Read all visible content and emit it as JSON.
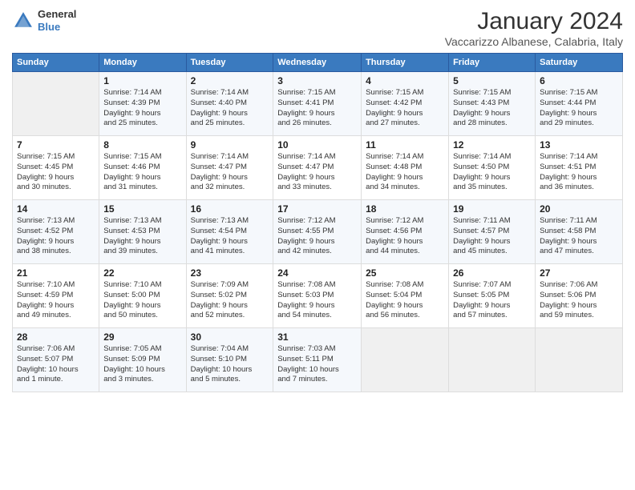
{
  "logo": {
    "general": "General",
    "blue": "Blue"
  },
  "header": {
    "month": "January 2024",
    "location": "Vaccarizzo Albanese, Calabria, Italy"
  },
  "weekdays": [
    "Sunday",
    "Monday",
    "Tuesday",
    "Wednesday",
    "Thursday",
    "Friday",
    "Saturday"
  ],
  "weeks": [
    [
      {
        "day": "",
        "info": ""
      },
      {
        "day": "1",
        "info": "Sunrise: 7:14 AM\nSunset: 4:39 PM\nDaylight: 9 hours\nand 25 minutes."
      },
      {
        "day": "2",
        "info": "Sunrise: 7:14 AM\nSunset: 4:40 PM\nDaylight: 9 hours\nand 25 minutes."
      },
      {
        "day": "3",
        "info": "Sunrise: 7:15 AM\nSunset: 4:41 PM\nDaylight: 9 hours\nand 26 minutes."
      },
      {
        "day": "4",
        "info": "Sunrise: 7:15 AM\nSunset: 4:42 PM\nDaylight: 9 hours\nand 27 minutes."
      },
      {
        "day": "5",
        "info": "Sunrise: 7:15 AM\nSunset: 4:43 PM\nDaylight: 9 hours\nand 28 minutes."
      },
      {
        "day": "6",
        "info": "Sunrise: 7:15 AM\nSunset: 4:44 PM\nDaylight: 9 hours\nand 29 minutes."
      }
    ],
    [
      {
        "day": "7",
        "info": "Sunrise: 7:15 AM\nSunset: 4:45 PM\nDaylight: 9 hours\nand 30 minutes."
      },
      {
        "day": "8",
        "info": "Sunrise: 7:15 AM\nSunset: 4:46 PM\nDaylight: 9 hours\nand 31 minutes."
      },
      {
        "day": "9",
        "info": "Sunrise: 7:14 AM\nSunset: 4:47 PM\nDaylight: 9 hours\nand 32 minutes."
      },
      {
        "day": "10",
        "info": "Sunrise: 7:14 AM\nSunset: 4:47 PM\nDaylight: 9 hours\nand 33 minutes."
      },
      {
        "day": "11",
        "info": "Sunrise: 7:14 AM\nSunset: 4:48 PM\nDaylight: 9 hours\nand 34 minutes."
      },
      {
        "day": "12",
        "info": "Sunrise: 7:14 AM\nSunset: 4:50 PM\nDaylight: 9 hours\nand 35 minutes."
      },
      {
        "day": "13",
        "info": "Sunrise: 7:14 AM\nSunset: 4:51 PM\nDaylight: 9 hours\nand 36 minutes."
      }
    ],
    [
      {
        "day": "14",
        "info": "Sunrise: 7:13 AM\nSunset: 4:52 PM\nDaylight: 9 hours\nand 38 minutes."
      },
      {
        "day": "15",
        "info": "Sunrise: 7:13 AM\nSunset: 4:53 PM\nDaylight: 9 hours\nand 39 minutes."
      },
      {
        "day": "16",
        "info": "Sunrise: 7:13 AM\nSunset: 4:54 PM\nDaylight: 9 hours\nand 41 minutes."
      },
      {
        "day": "17",
        "info": "Sunrise: 7:12 AM\nSunset: 4:55 PM\nDaylight: 9 hours\nand 42 minutes."
      },
      {
        "day": "18",
        "info": "Sunrise: 7:12 AM\nSunset: 4:56 PM\nDaylight: 9 hours\nand 44 minutes."
      },
      {
        "day": "19",
        "info": "Sunrise: 7:11 AM\nSunset: 4:57 PM\nDaylight: 9 hours\nand 45 minutes."
      },
      {
        "day": "20",
        "info": "Sunrise: 7:11 AM\nSunset: 4:58 PM\nDaylight: 9 hours\nand 47 minutes."
      }
    ],
    [
      {
        "day": "21",
        "info": "Sunrise: 7:10 AM\nSunset: 4:59 PM\nDaylight: 9 hours\nand 49 minutes."
      },
      {
        "day": "22",
        "info": "Sunrise: 7:10 AM\nSunset: 5:00 PM\nDaylight: 9 hours\nand 50 minutes."
      },
      {
        "day": "23",
        "info": "Sunrise: 7:09 AM\nSunset: 5:02 PM\nDaylight: 9 hours\nand 52 minutes."
      },
      {
        "day": "24",
        "info": "Sunrise: 7:08 AM\nSunset: 5:03 PM\nDaylight: 9 hours\nand 54 minutes."
      },
      {
        "day": "25",
        "info": "Sunrise: 7:08 AM\nSunset: 5:04 PM\nDaylight: 9 hours\nand 56 minutes."
      },
      {
        "day": "26",
        "info": "Sunrise: 7:07 AM\nSunset: 5:05 PM\nDaylight: 9 hours\nand 57 minutes."
      },
      {
        "day": "27",
        "info": "Sunrise: 7:06 AM\nSunset: 5:06 PM\nDaylight: 9 hours\nand 59 minutes."
      }
    ],
    [
      {
        "day": "28",
        "info": "Sunrise: 7:06 AM\nSunset: 5:07 PM\nDaylight: 10 hours\nand 1 minute."
      },
      {
        "day": "29",
        "info": "Sunrise: 7:05 AM\nSunset: 5:09 PM\nDaylight: 10 hours\nand 3 minutes."
      },
      {
        "day": "30",
        "info": "Sunrise: 7:04 AM\nSunset: 5:10 PM\nDaylight: 10 hours\nand 5 minutes."
      },
      {
        "day": "31",
        "info": "Sunrise: 7:03 AM\nSunset: 5:11 PM\nDaylight: 10 hours\nand 7 minutes."
      },
      {
        "day": "",
        "info": ""
      },
      {
        "day": "",
        "info": ""
      },
      {
        "day": "",
        "info": ""
      }
    ]
  ]
}
